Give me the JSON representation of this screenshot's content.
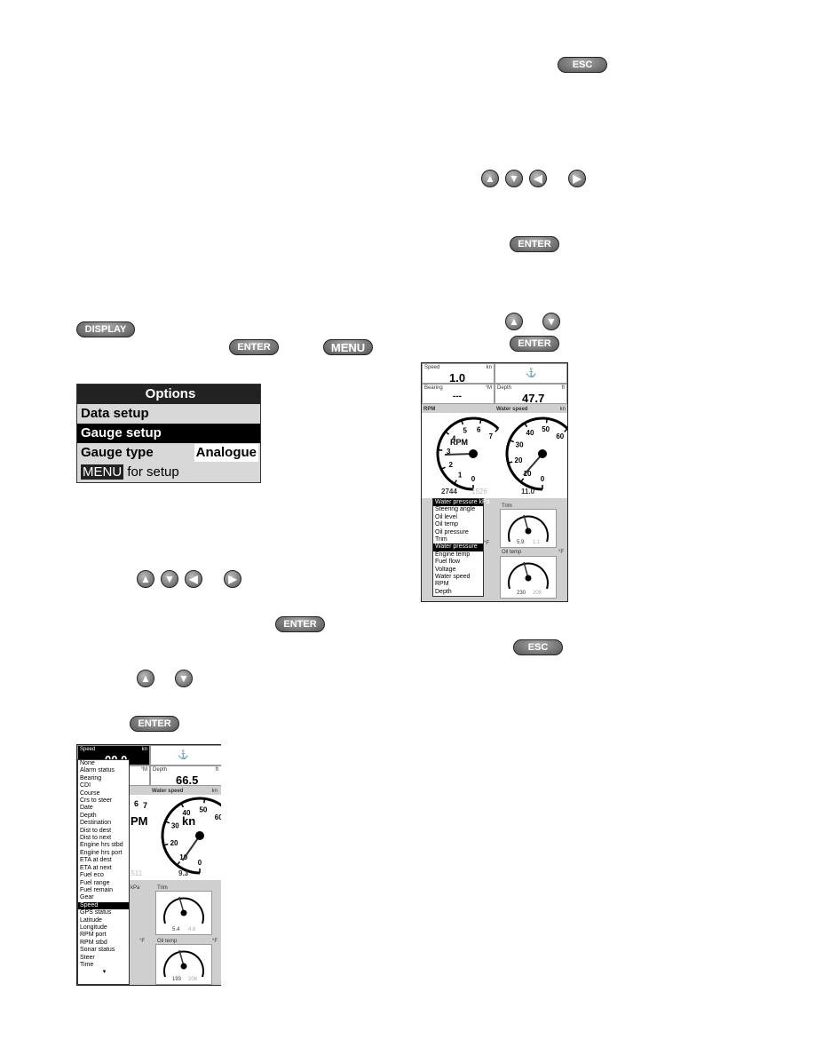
{
  "buttons": {
    "esc": "ESC",
    "enter": "ENTER",
    "display": "DISPLAY",
    "menu": "MENU"
  },
  "options": {
    "title": "Options",
    "items": [
      "Data setup",
      "Gauge setup"
    ],
    "gauge_type_label": "Gauge type",
    "gauge_type_value": "Analogue",
    "menu_key": "MENU",
    "menu_text": " for setup"
  },
  "shot1": {
    "speed_label": "Speed",
    "speed_unit": "kn",
    "speed_value": "1.0",
    "bearing_label": "Bearing",
    "bearing_unit": "°M",
    "bearing_value": "---",
    "depth_label": "Depth",
    "depth_unit": "ft",
    "depth_value": "47.7",
    "rpm_label": "RPM",
    "rpm_center": "RPM",
    "rpm_ticks": [
      "0",
      "1",
      "2",
      "3",
      "4",
      "5",
      "6",
      "7"
    ],
    "rpm_value": "2744",
    "rpm_value2": "1526",
    "ws_label": "Water speed",
    "ws_unit": "kn",
    "ws_ticks": [
      "0",
      "10",
      "20",
      "30",
      "40",
      "50",
      "60"
    ],
    "ws_value": "11.0",
    "trim_label": "Trim",
    "oil_label": "Oil temp",
    "oil_unit": "°F",
    "f_unit": "°F",
    "trim_vals": [
      "5.9",
      "1.1"
    ],
    "oil_vals": [
      "230",
      "208"
    ],
    "list_header": "Water pressure  kPa",
    "list": [
      "Steering angle",
      "Oil level",
      "Oil temp",
      "Oil pressure",
      "Trim",
      "Water pressure",
      "Engine temp",
      "Fuel flow",
      "Voltage",
      "Water speed",
      "RPM",
      "Depth"
    ],
    "list_selected": 5
  },
  "shot2": {
    "speed_label": "Speed",
    "speed_unit": "kn",
    "speed_value": "00.0",
    "bearing_unit": "°M",
    "depth_label": "Depth",
    "depth_unit": "ft",
    "depth_value": "66.5",
    "ws_label": "Water speed",
    "ws_unit": "kn",
    "ws_center": "kn",
    "ws_ticks": [
      "0",
      "10",
      "20",
      "30",
      "40",
      "50",
      "60"
    ],
    "ws_value": "9.3",
    "rpm_partial": "PM",
    "rpm_ticks_partial": [
      "6",
      "7"
    ],
    "rpm_value_partial": "1511",
    "kpa": "kPa",
    "f_unit": "°F",
    "trim_label": "Trim",
    "oil_label": "Oil temp",
    "oil_unit": "°F",
    "trim_vals": [
      "5.4",
      "4.8"
    ],
    "oil_vals": [
      "193",
      "208"
    ],
    "list": [
      "None",
      "Alarm status",
      "Bearing",
      "CDI",
      "Course",
      "Crs to steer",
      "Date",
      "Depth",
      "Destination",
      "Dist to dest",
      "Dist to next",
      "Engine hrs stbd",
      "Engine hrs port",
      "ETA at dest",
      "ETA at next",
      "Fuel eco",
      "Fuel range",
      "Fuel remain",
      "Gear",
      "Speed",
      "GPS status",
      "Latitude",
      "Longitude",
      "RPM port",
      "RPM stbd",
      "Sonar status",
      "Steer",
      "Time"
    ],
    "list_selected": 19
  }
}
